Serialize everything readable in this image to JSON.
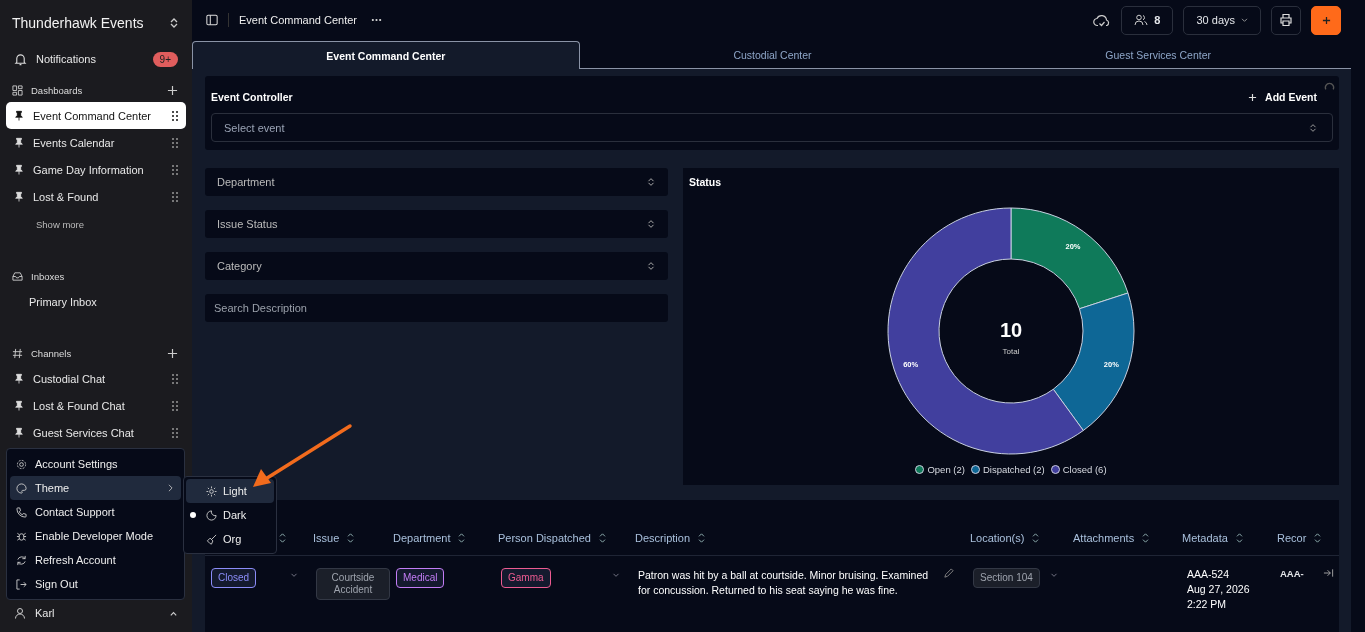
{
  "app": {
    "name": "Thunderhawk Events"
  },
  "notifications": {
    "label": "Notifications",
    "badge": "9+"
  },
  "sections": [
    {
      "kind": "dashboards",
      "title": "Dashboards",
      "add_button": true,
      "more": "Show more",
      "items": [
        {
          "label": "Event Command Center",
          "selected": true,
          "pinned": true
        },
        {
          "label": "Events Calendar",
          "selected": false,
          "pinned": true
        },
        {
          "label": "Game Day Information",
          "selected": false,
          "pinned": true
        },
        {
          "label": "Lost & Found",
          "selected": false,
          "pinned": true
        }
      ]
    },
    {
      "kind": "inboxes",
      "title": "Inboxes",
      "add_button": false,
      "items": [
        {
          "label": "Primary Inbox",
          "selected": false,
          "pinned": false
        }
      ]
    },
    {
      "kind": "channels",
      "title": "Channels",
      "add_button": true,
      "items": [
        {
          "label": "Custodial Chat",
          "selected": false,
          "pinned": true
        },
        {
          "label": "Lost & Found Chat",
          "selected": false,
          "pinned": true
        },
        {
          "label": "Guest Services Chat",
          "selected": false,
          "pinned": true
        }
      ]
    }
  ],
  "user": {
    "name": "Karl"
  },
  "account_menu": [
    {
      "kind": "settings",
      "label": "Account Settings",
      "highlighted": false,
      "submenu": false
    },
    {
      "kind": "theme",
      "label": "Theme",
      "highlighted": true,
      "submenu": true
    },
    {
      "kind": "phone",
      "label": "Contact Support",
      "highlighted": false,
      "submenu": false
    },
    {
      "kind": "bug",
      "label": "Enable Developer Mode",
      "highlighted": false,
      "submenu": false
    },
    {
      "kind": "refresh",
      "label": "Refresh Account",
      "highlighted": false,
      "submenu": false
    },
    {
      "kind": "signout",
      "label": "Sign Out",
      "highlighted": false,
      "submenu": false
    }
  ],
  "theme_menu": [
    {
      "kind": "light",
      "label": "Light",
      "highlighted": true,
      "selected": false
    },
    {
      "kind": "dark",
      "label": "Dark",
      "highlighted": false,
      "selected": true
    },
    {
      "kind": "org",
      "label": "Org",
      "highlighted": false,
      "selected": false
    }
  ],
  "header": {
    "title": "Event Command Center",
    "members": "8",
    "range": "30 days"
  },
  "tabs": [
    {
      "label": "Event Command Center",
      "selected": true
    },
    {
      "label": "Custodial Center",
      "selected": false
    },
    {
      "label": "Guest Services Center",
      "selected": false
    }
  ],
  "event_controller": {
    "title": "Event Controller",
    "add_label": "Add Event",
    "select_placeholder": "Select event"
  },
  "filters": [
    {
      "kind": "select",
      "placeholder": "Department"
    },
    {
      "kind": "select",
      "placeholder": "Issue Status"
    },
    {
      "kind": "select",
      "placeholder": "Category"
    },
    {
      "kind": "search",
      "placeholder": "Search Description"
    }
  ],
  "status": {
    "total": "10",
    "total_label": "Total",
    "legend_counts": [
      "(2)",
      "(2)",
      "(6)"
    ],
    "chart_data": {
      "type": "donut",
      "title": "Status",
      "categories": [
        "Open",
        "Dispatched",
        "Closed"
      ],
      "values": [
        20,
        20,
        60
      ],
      "colors": [
        "#0f7a5a",
        "#0e6796",
        "#413f9e"
      ],
      "value_labels": [
        "20%",
        "20%",
        "60%"
      ]
    }
  },
  "table": {
    "columns": [
      {},
      {
        "label": "Issue"
      },
      {
        "label": "Department"
      },
      {
        "label": "Person Dispatched"
      },
      {
        "label": "Description"
      },
      {
        "label": "Location(s)"
      },
      {
        "label": "Attachments"
      },
      {
        "label": "Metadata"
      },
      {
        "label": "Recor"
      }
    ],
    "rows": [
      {
        "status": {
          "text": "Closed",
          "color": "#8b8cf8"
        },
        "issue": "Courtside Accident",
        "department": {
          "text": "Medical",
          "color": "#c27cf5"
        },
        "person": {
          "text": "Gamma",
          "color": "#ec5b91"
        },
        "description": "Patron was hit by a ball at courtside. Minor bruising. Examined for concussion. Returned to his seat saying he was fine.",
        "location": "Section 104",
        "metadata": [
          "AAA-524",
          "Aug 27, 2026",
          "2:22 PM"
        ],
        "record": "AAA-"
      }
    ]
  }
}
